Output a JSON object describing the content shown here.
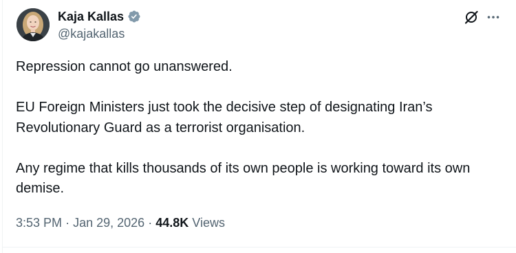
{
  "author": {
    "name": "Kaja Kallas",
    "handle": "@kajakallas",
    "verified_icon": "verified-badge-gray",
    "badge_color": "#829aab"
  },
  "header_icons": {
    "grok": "grok-icon",
    "more": "more-icon"
  },
  "tweet": {
    "paragraphs": [
      "Repression cannot go unanswered.",
      "EU Foreign Ministers just took the decisive step of designating Iran’s Revolutionary Guard as a terrorist organisation.",
      "Any regime that kills thousands of its own people is working toward its own demise."
    ]
  },
  "meta": {
    "time": "3:53 PM",
    "separator": "·",
    "date": "Jan 29, 2026",
    "views_count": "44.8K",
    "views_label": "Views"
  },
  "colors": {
    "text_primary": "#0f1419",
    "text_secondary": "#536471",
    "border": "#eff3f4"
  }
}
